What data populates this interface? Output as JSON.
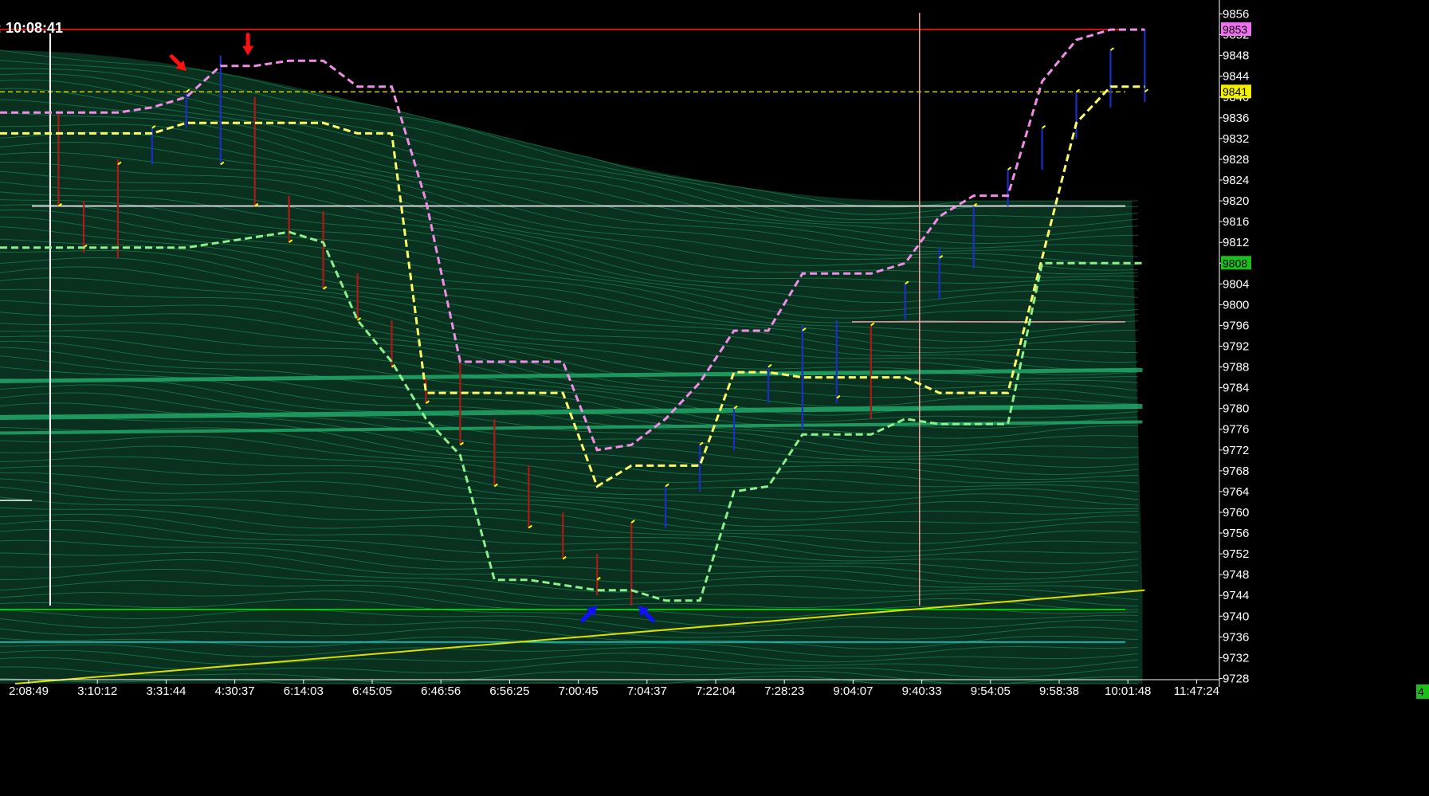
{
  "header": {
    "clock": ": 10:08:41"
  },
  "colors": {
    "background": "#000000",
    "mesh": "#1fa866",
    "upper_band": "#f08ee6",
    "middle_band": "#ffff66",
    "lower_band": "#8cf08c",
    "up_bar": "#1a2ec8",
    "down_bar": "#b01818",
    "resistance": "#d01010",
    "support": "#00e000",
    "cyan_line": "#00e0e0",
    "trend": "#e0e000",
    "price_tag_pink": "#f070f0",
    "price_tag_yellow": "#f0f000",
    "price_tag_green": "#18c018",
    "arrow_red": "#ff1010",
    "arrow_blue": "#1010ff"
  },
  "chart_data": {
    "type": "line",
    "x_labels": [
      "2:08:49",
      "3:10:12",
      "3:31:44",
      "4:30:37",
      "6:14:03",
      "6:45:05",
      "6:46:56",
      "6:56:25",
      "7:00:45",
      "7:04:37",
      "7:22:04",
      "7:28:23",
      "9:04:07",
      "9:40:33",
      "9:54:05",
      "9:58:38",
      "10:01:48",
      "11:47:24"
    ],
    "y_ticks": [
      9856,
      9852,
      9848,
      9844,
      9840,
      9836,
      9832,
      9828,
      9824,
      9820,
      9816,
      9812,
      9808,
      9804,
      9800,
      9796,
      9792,
      9788,
      9784,
      9780,
      9776,
      9772,
      9768,
      9764,
      9760,
      9756,
      9752,
      9748,
      9744,
      9740,
      9736,
      9732,
      9728
    ],
    "ylim": [
      9727,
      9857
    ],
    "y_ticks_visible": [
      "9856",
      "9852",
      "9848",
      "9844",
      "9840",
      "9836",
      "9832",
      "9828",
      "9824",
      "9820",
      "9816",
      "9812",
      "9808",
      "9804",
      "9800",
      "9796",
      "9792",
      "9788",
      "9784",
      "9780",
      "9776",
      "9772",
      "9768",
      "9764",
      "9760",
      "9756",
      "9752",
      "9748",
      "9744",
      "9740",
      "9736",
      "9732",
      "9728"
    ],
    "price_tags": [
      {
        "text": "9853",
        "value": 9853,
        "color": "#f070f0"
      },
      {
        "text": "9841",
        "value": 9841,
        "color": "#f0f000"
      },
      {
        "text": "9808",
        "value": 9808,
        "color": "#18c018"
      }
    ],
    "bottom_right_badge": "4",
    "horizontal_lines": [
      {
        "value": 9853,
        "color": "#d01010"
      },
      {
        "value": 9841,
        "color": "#d0d000",
        "dashed": true
      },
      {
        "value": 9819,
        "color": "#ffffff"
      },
      {
        "value": 9796.7,
        "color": "#f0a0a0"
      },
      {
        "value": 9741.3,
        "color": "#00e000"
      },
      {
        "value": 9735,
        "color": "#00e0e0"
      }
    ],
    "upper_band": {
      "index": [
        -0.1,
        0,
        0.5,
        1,
        1.5,
        2,
        2.5,
        3,
        3.5,
        4,
        4.5,
        5,
        5.5,
        6,
        6.5,
        7,
        7.5,
        8,
        8.5,
        9,
        9.5,
        10,
        10.5,
        11,
        11.5,
        12,
        12.5,
        13,
        13.5,
        14,
        14.5,
        15,
        15.5,
        16
      ],
      "values": [
        9837,
        9837,
        9837,
        9837,
        9838,
        9840,
        9846,
        9846,
        9847,
        9847,
        9842,
        9842,
        9820,
        9789,
        9789,
        9789,
        9789,
        9772,
        9773,
        9778,
        9785,
        9795,
        9795,
        9806,
        9806,
        9806,
        9808,
        9817,
        9821,
        9821,
        9843,
        9851,
        9853,
        9853
      ]
    },
    "middle_band": {
      "index": [
        -0.1,
        0,
        0.5,
        1,
        1.5,
        2,
        2.5,
        3,
        3.5,
        4,
        4.5,
        5,
        5.5,
        6,
        6.5,
        7,
        7.5,
        8,
        8.5,
        9,
        9.5,
        10,
        10.5,
        11,
        11.5,
        12,
        12.5,
        13,
        13.5,
        14,
        14.5,
        15,
        15.5,
        16
      ],
      "values": [
        9833,
        9833,
        9833,
        9833,
        9833,
        9835,
        9835,
        9835,
        9835,
        9835,
        9833,
        9833,
        9783,
        9783,
        9783,
        9783,
        9783,
        9765,
        9769,
        9769,
        9769,
        9787,
        9787,
        9786,
        9786,
        9786,
        9786,
        9783,
        9783,
        9783,
        9809,
        9835,
        9842,
        9842
      ]
    },
    "lower_band": {
      "index": [
        -0.1,
        0,
        0.5,
        1,
        1.5,
        2,
        2.5,
        3,
        3.5,
        4,
        4.5,
        5,
        5.5,
        6,
        6.5,
        7,
        7.5,
        8,
        8.5,
        9,
        9.5,
        10,
        10.5,
        11,
        11.5,
        12,
        12.5,
        13,
        13.5,
        14,
        14.5,
        15,
        15.5,
        16
      ],
      "values": [
        9811,
        9811,
        9811,
        9811,
        9811,
        9811,
        9812,
        9813,
        9814,
        9812,
        9797,
        9789,
        9778,
        9771,
        9747,
        9747,
        9746,
        9745,
        9745,
        9743,
        9743,
        9764,
        9765,
        9775,
        9775,
        9775,
        9778,
        9777,
        9777,
        9777,
        9808,
        9808,
        9808,
        9808
      ]
    },
    "bars": [
      {
        "index": -0.1,
        "high": 9837,
        "low": 9819,
        "close": 9819,
        "dir": "down"
      },
      {
        "index": 0.5,
        "high": 9820,
        "low": 9810,
        "close": 9811,
        "dir": "down"
      },
      {
        "index": 1.0,
        "high": 9828,
        "low": 9809,
        "close": 9827,
        "dir": "down"
      },
      {
        "index": 1.5,
        "high": 9834,
        "low": 9827,
        "close": 9834,
        "dir": "up"
      },
      {
        "index": 2.0,
        "high": 9841,
        "low": 9834,
        "close": 9841,
        "dir": "up"
      },
      {
        "index": 2.5,
        "high": 9848,
        "low": 9827,
        "close": 9827,
        "dir": "up"
      },
      {
        "index": 3.0,
        "high": 9840,
        "low": 9819,
        "close": 9819,
        "dir": "down"
      },
      {
        "index": 3.5,
        "high": 9821,
        "low": 9812,
        "close": 9812,
        "dir": "down"
      },
      {
        "index": 4.0,
        "high": 9818,
        "low": 9803,
        "close": 9803,
        "dir": "down"
      },
      {
        "index": 4.5,
        "high": 9806,
        "low": 9797,
        "close": 9797,
        "dir": "down"
      },
      {
        "index": 5.0,
        "high": 9797,
        "low": 9788,
        "close": 9788,
        "dir": "down"
      },
      {
        "index": 5.5,
        "high": 9786,
        "low": 9781,
        "close": 9781,
        "dir": "down"
      },
      {
        "index": 6.0,
        "high": 9789,
        "low": 9773,
        "close": 9773,
        "dir": "down"
      },
      {
        "index": 6.5,
        "high": 9778,
        "low": 9765,
        "close": 9765,
        "dir": "down"
      },
      {
        "index": 7.0,
        "high": 9769,
        "low": 9757,
        "close": 9757,
        "dir": "down"
      },
      {
        "index": 7.5,
        "high": 9760,
        "low": 9751,
        "close": 9751,
        "dir": "down"
      },
      {
        "index": 8.0,
        "high": 9752,
        "low": 9744,
        "close": 9747,
        "dir": "down"
      },
      {
        "index": 8.5,
        "high": 9758,
        "low": 9742,
        "close": 9758,
        "dir": "down"
      },
      {
        "index": 9.0,
        "high": 9765,
        "low": 9757,
        "close": 9765,
        "dir": "up"
      },
      {
        "index": 9.5,
        "high": 9773,
        "low": 9764,
        "close": 9773,
        "dir": "up"
      },
      {
        "index": 10.0,
        "high": 9780,
        "low": 9772,
        "close": 9780,
        "dir": "up"
      },
      {
        "index": 10.5,
        "high": 9788,
        "low": 9781,
        "close": 9788,
        "dir": "up"
      },
      {
        "index": 11.0,
        "high": 9796,
        "low": 9776,
        "close": 9795,
        "dir": "up"
      },
      {
        "index": 11.5,
        "high": 9797,
        "low": 9781,
        "close": 9782,
        "dir": "up"
      },
      {
        "index": 12.0,
        "high": 9796,
        "low": 9778,
        "close": 9796,
        "dir": "down"
      },
      {
        "index": 12.5,
        "high": 9804,
        "low": 9797,
        "close": 9804,
        "dir": "up"
      },
      {
        "index": 13.0,
        "high": 9811,
        "low": 9801,
        "close": 9809,
        "dir": "up"
      },
      {
        "index": 13.5,
        "high": 9819,
        "low": 9807,
        "close": 9819,
        "dir": "up"
      },
      {
        "index": 14.0,
        "high": 9826,
        "low": 9819,
        "close": 9826,
        "dir": "up"
      },
      {
        "index": 14.5,
        "high": 9834,
        "low": 9826,
        "close": 9834,
        "dir": "up"
      },
      {
        "index": 15.0,
        "high": 9841,
        "low": 9832,
        "close": 9841,
        "dir": "up"
      },
      {
        "index": 15.5,
        "high": 9849,
        "low": 9838,
        "close": 9849,
        "dir": "up"
      },
      {
        "index": 16.0,
        "high": 9853,
        "low": 9839,
        "close": 9841,
        "dir": "up"
      }
    ],
    "trend_line": {
      "from": {
        "index": -0.5,
        "value": 9727
      },
      "to": {
        "index": 16.0,
        "value": 9745
      }
    },
    "crosshair_index": 12.5,
    "cursor_index": 0.5,
    "markers": [
      {
        "color": "red",
        "direction": "down-right",
        "index": 2.0,
        "value": 9845
      },
      {
        "color": "red",
        "direction": "down",
        "index": 2.9,
        "value": 9848
      },
      {
        "color": "blue",
        "direction": "up-right",
        "index": 8.0,
        "value": 9742
      },
      {
        "color": "blue",
        "direction": "up-left",
        "index": 8.6,
        "value": 9742
      }
    ]
  }
}
